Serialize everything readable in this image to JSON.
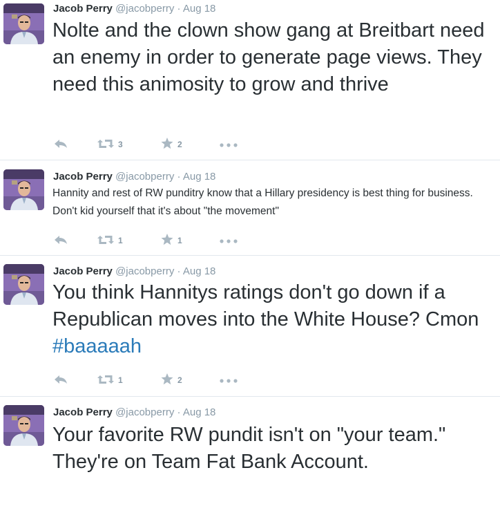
{
  "tweets": [
    {
      "name": "Jacob Perry",
      "handle": "@jacobperry",
      "separator": "·",
      "time": "Aug 18",
      "text": "Nolte and the clown show gang at Breitbart need an enemy in order to generate page views. They need this animosity to grow and thrive",
      "hashtag": "",
      "retweets": "3",
      "favorites": "2"
    },
    {
      "name": "Jacob Perry",
      "handle": "@jacobperry",
      "separator": "·",
      "time": "Aug 18",
      "text": "Hannity and rest of RW punditry know that a Hillary presidency is best thing for business. Don't kid yourself that it's about \"the movement\"",
      "hashtag": "",
      "retweets": "1",
      "favorites": "1"
    },
    {
      "name": "Jacob Perry",
      "handle": "@jacobperry",
      "separator": "·",
      "time": "Aug 18",
      "text": "You think Hannitys ratings don't go down if a Republican moves into the White House? Cmon ",
      "hashtag": "#baaaaah",
      "retweets": "1",
      "favorites": "2"
    },
    {
      "name": "Jacob Perry",
      "handle": "@jacobperry",
      "separator": "·",
      "time": "Aug 18",
      "text": "Your favorite RW pundit isn't on \"your team.\" They're on Team Fat Bank Account.",
      "hashtag": ""
    }
  ],
  "icons": {
    "reply": "reply-icon",
    "retweet": "retweet-icon",
    "favorite": "star-icon",
    "more": "more-icon"
  },
  "colors": {
    "name": "#292f33",
    "meta": "#8899a6",
    "hashtag": "#2b7bb9",
    "action_icon": "#aab8c2",
    "divider": "#e1e8ed"
  }
}
